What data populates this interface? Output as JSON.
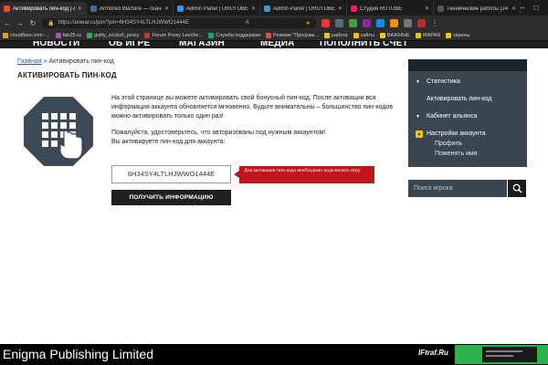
{
  "browser": {
    "tabs": [
      {
        "title": "Активировать пин-код | A",
        "color": "#e74c3c",
        "active": true
      },
      {
        "title": "Armored Warfare — скача",
        "color": "#3a6ea5",
        "active": false
      },
      {
        "title": "Admin Panel | URUTUBE G",
        "color": "#3498db",
        "active": false
      },
      {
        "title": "Admin Panel | URUTUBE G",
        "color": "#3498db",
        "active": false
      },
      {
        "title": "Студия RUTUBE",
        "color": "#e91e63",
        "active": false
      },
      {
        "title": "Технические работы [24",
        "color": "#555555",
        "active": false
      }
    ],
    "url": "https://anwar.ru/pin/?pin=6H34SY4LTLHJWWO1444E"
  },
  "bookmarks": [
    {
      "label": "cloudflare.com -...",
      "color": "#f39c12"
    },
    {
      "label": "fab25.ru",
      "color": "#9b59b6"
    },
    {
      "label": "guilty_socks5_proxy",
      "color": "#27ae60"
    },
    {
      "label": "Forum Proxy Leeche...",
      "color": "#c0392b"
    },
    {
      "label": "Служба поддержки",
      "color": "#16a085"
    },
    {
      "label": "Резюме \"Програм...",
      "color": "#e74c3c"
    },
    {
      "label": "работа",
      "color": "#f1c40f"
    },
    {
      "label": "сайты",
      "color": "#f1c40f"
    },
    {
      "label": "ВАЖНЫЕ",
      "color": "#f1c40f"
    },
    {
      "label": "WAPAR",
      "color": "#f1c40f"
    },
    {
      "label": "скрины",
      "color": "#f1c40f"
    }
  ],
  "site_nav": [
    "НОВОСТИ",
    "ОБ ИГРЕ",
    "МАГАЗИН",
    "МЕДИА",
    "ПОПОЛНИТЬ СЧЕТ"
  ],
  "breadcrumb": {
    "home": "Главная",
    "sep": " » ",
    "current": "Активировать пин-код"
  },
  "page_title": "АКТИВИРОВАТЬ ПИН-КОД",
  "description": {
    "p1": "На этой странице вы можете активировать свой бонусный пин-код. После активации вся информация аккаунта обновляется мгновенно. Будьте внимательны – большинство пин-кодов можно активировать только один раз!",
    "p2a": "Пожалуйста, удостоверьтесь, что авторизованы под нужным аккаунтом!",
    "p2b": "Вы активируете пин-код для аккаунта:"
  },
  "pin_input": {
    "value": "6H34SY4LTLHJWWO1444E"
  },
  "tooltip": "Для активации пин-кода необходимо подключить игру",
  "submit_label": "ПОЛУЧИТЬ ИНФОРМАЦИЮ",
  "sidebar": {
    "statistics": "Статистика",
    "activate_pin": "Активировать пин-код",
    "alliance": "Кабинет альянса",
    "settings": "Настройки аккаунта",
    "profile": "Профиль",
    "change_name": "Поменять имя"
  },
  "search": {
    "placeholder": "Поиск игрока"
  },
  "footer": {
    "company": "Enigma Publishing Limited",
    "ad_logo": "IFtraf.Ru"
  },
  "colors": {
    "accent_red": "#c0151a",
    "sidebar_bg": "#3a4652",
    "badge_yellow": "#f1c40f"
  }
}
